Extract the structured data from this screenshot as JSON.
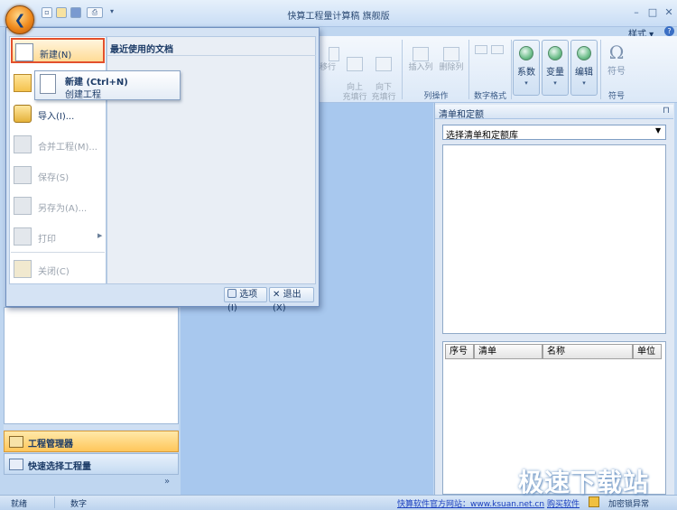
{
  "window": {
    "title": "快算工程量计算稿 旗舰版",
    "min": "–",
    "max": "□",
    "close": "✕",
    "style_menu": "样式 ▾",
    "help": "?",
    "mdi_min": "–",
    "mdi_max": "□",
    "mdi_close": "✕"
  },
  "ribbon": {
    "buttons": {
      "move_row": "移行",
      "fill_up": "向上\n充填行",
      "fill_down": "向下\n充填行",
      "insert_col": "插入列",
      "delete_col": "删除列",
      "coefficient": "系数",
      "variable": "变量",
      "edit": "编辑",
      "symbol": "符号"
    },
    "groups": {
      "col_ops": "列操作",
      "num_format": "数字格式",
      "symbol": "符号"
    }
  },
  "app_menu": {
    "recent_docs": "最近使用的文档",
    "items": {
      "new": "新建(N)",
      "import": "导入(I)...",
      "merge": "合并工程(M)...",
      "save": "保存(S)",
      "save_as": "另存为(A)...",
      "print": "打印",
      "close": "关闭(C)"
    },
    "options": "选项(I)",
    "exit": "退出(X)"
  },
  "tooltip": {
    "title": "新建 (Ctrl+N)",
    "desc": "创建工程"
  },
  "nav": {
    "project_manager": "工程管理器",
    "quick_select": "快速选择工程量",
    "more": "»"
  },
  "right_panel": {
    "title": "清单和定额",
    "pin": "⊓",
    "select_value": "选择清单和定额库",
    "columns": [
      "序号",
      "清单",
      "名称",
      "单位"
    ]
  },
  "status": {
    "ready": "就绪",
    "num": "数字",
    "site_link": "快算软件官方网站：www.ksuan.net.cn",
    "buy": "购买软件",
    "lock": "加密锁异常"
  },
  "watermark": "极速下载站"
}
